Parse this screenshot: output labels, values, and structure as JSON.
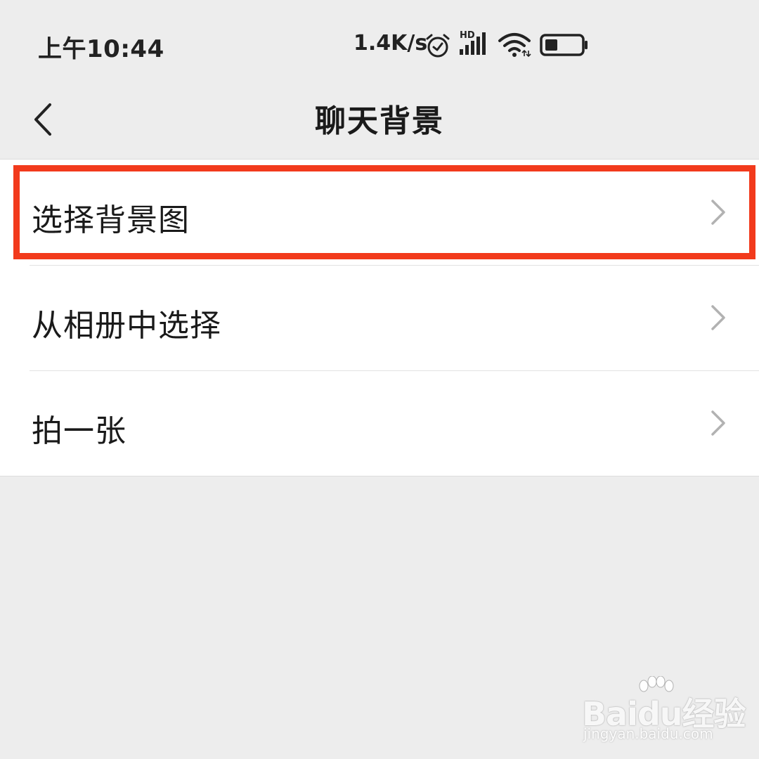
{
  "status_bar": {
    "time": "上午10:44",
    "network_speed": "1.4K/s",
    "signal_type": "HD",
    "icons": [
      "alarm-icon",
      "hd-signal-icon",
      "wifi-icon",
      "battery-icon"
    ],
    "battery_level": 0.35
  },
  "nav": {
    "title": "聊天背景",
    "back_icon": "chevron-left-icon"
  },
  "menu": {
    "items": [
      {
        "label": "选择背景图",
        "highlighted": true
      },
      {
        "label": "从相册中选择",
        "highlighted": false
      },
      {
        "label": "拍一张",
        "highlighted": false
      }
    ],
    "chevron_icon": "chevron-right-icon"
  },
  "colors": {
    "background": "#ededed",
    "list_background": "#ffffff",
    "highlight": "#f23a1c",
    "chevron": "#b2b2b2"
  },
  "watermark": {
    "logo_text": "Baidu经验",
    "url": "jingyan.baidu.com"
  }
}
